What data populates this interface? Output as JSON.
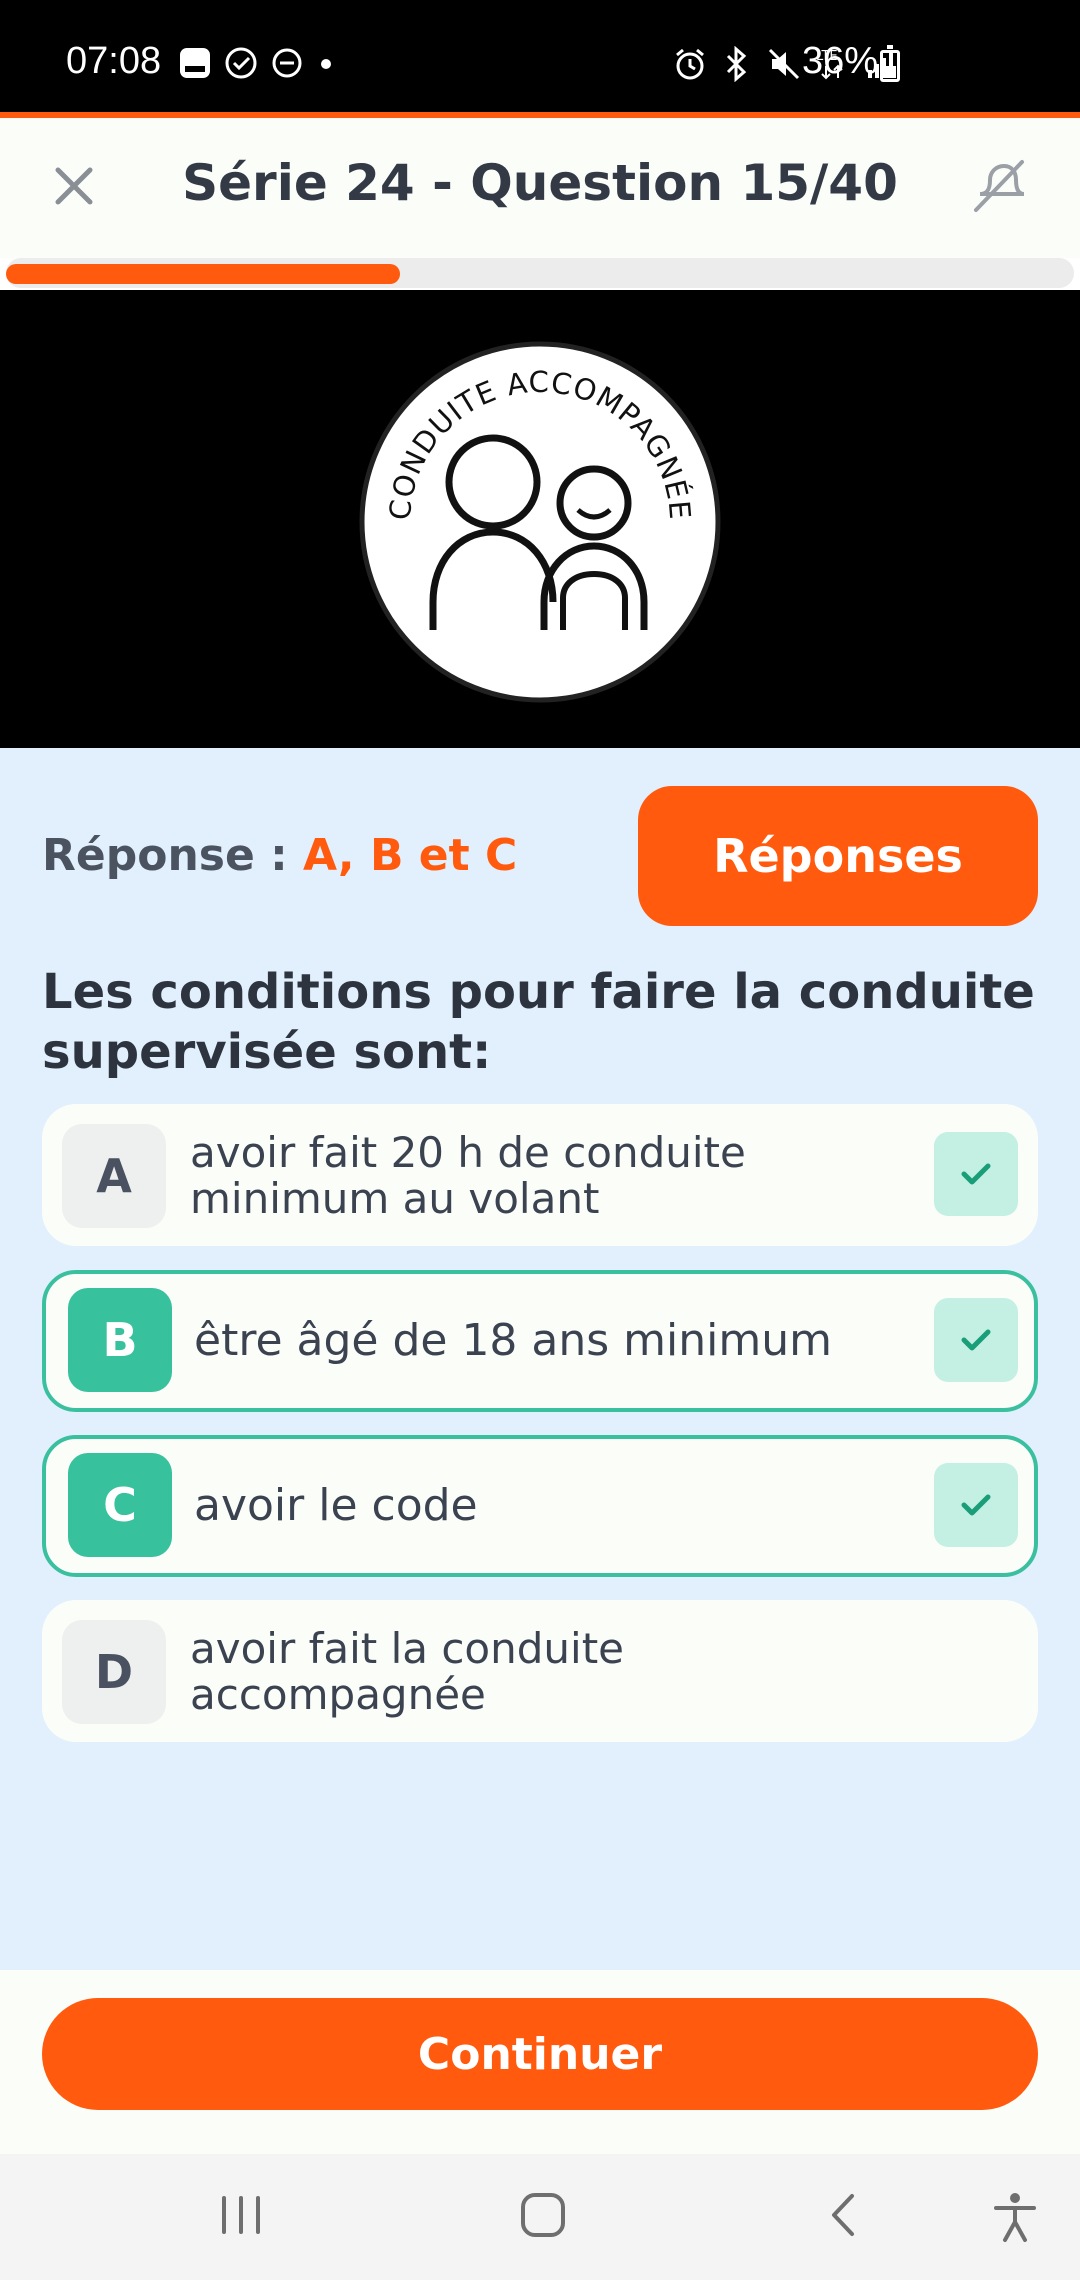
{
  "status_bar": {
    "time": "07:08",
    "battery": "36%",
    "network": "LTE"
  },
  "header": {
    "title": "Série 24 - Question 15/40",
    "progress": 0.375
  },
  "sign": {
    "text": "CONDUITE ACCOMPAGNÉE"
  },
  "answer": {
    "label": "Réponse :",
    "value": "A, B et C"
  },
  "responses_button": "Réponses",
  "question": "Les conditions pour faire la conduite supervisée sont:",
  "options": [
    {
      "letter": "A",
      "text": "avoir fait 20 h de conduite minimum au volant"
    },
    {
      "letter": "B",
      "text": "être âgé de 18 ans minimum"
    },
    {
      "letter": "C",
      "text": "avoir le code"
    },
    {
      "letter": "D",
      "text": "avoir fait la conduite accompagnée"
    }
  ],
  "continue_button": "Continuer",
  "colors": {
    "accent": "#ff5a0d",
    "correct": "#37c19c",
    "background": "#e1f0fc"
  }
}
